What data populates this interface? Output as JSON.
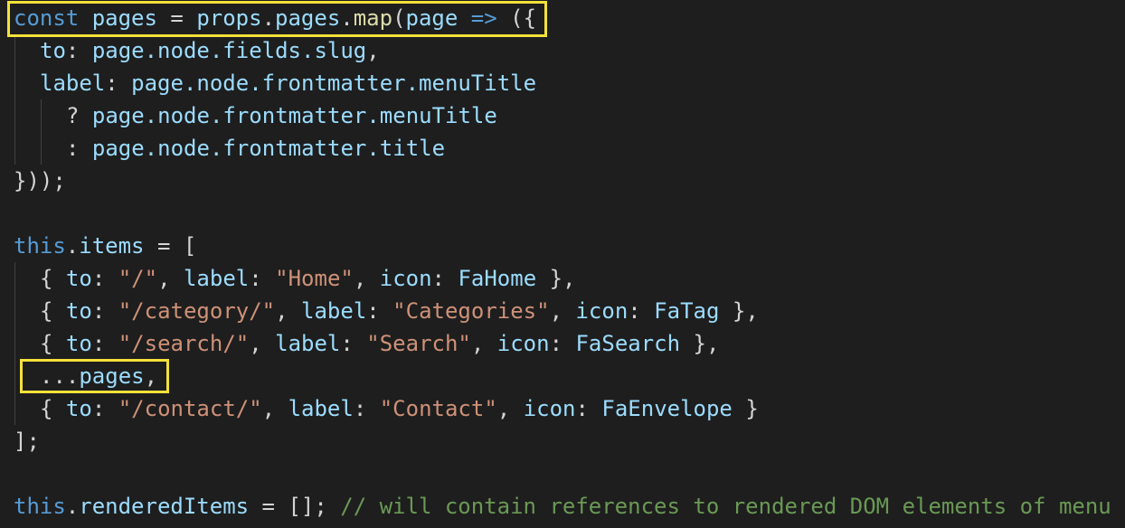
{
  "code": {
    "l1": {
      "kw_const": "const",
      "sp1": " ",
      "pages": "pages",
      "eq": " = ",
      "props": "props",
      "dot1": ".",
      "pages2": "pages",
      "dot2": ".",
      "map": "map",
      "paren": "(",
      "page": "page",
      "arrow_sp": " ",
      "arrow": "=>",
      "tail": " ({"
    },
    "l2": {
      "key": "to",
      "colon": ": ",
      "expr": "page.node.fields.slug",
      "comma": ","
    },
    "l3": {
      "key": "label",
      "colon": ": ",
      "expr": "page.node.frontmatter.menuTitle"
    },
    "l4": {
      "op": "? ",
      "expr": "page.node.frontmatter.menuTitle"
    },
    "l5": {
      "op": ": ",
      "expr": "page.node.frontmatter.title"
    },
    "l6": {
      "text": "}));"
    },
    "l8": {
      "this": "this",
      "dot": ".",
      "items": "items",
      "rest": " = ["
    },
    "l9": {
      "open": "{ ",
      "to": "to",
      "c1": ": ",
      "to_val": "\"/\"",
      "s1": ", ",
      "label": "label",
      "c2": ": ",
      "label_val": "\"Home\"",
      "s2": ", ",
      "icon": "icon",
      "c3": ": ",
      "icon_val": "FaHome",
      "close": " },"
    },
    "l10": {
      "open": "{ ",
      "to": "to",
      "c1": ": ",
      "to_val": "\"/category/\"",
      "s1": ", ",
      "label": "label",
      "c2": ": ",
      "label_val": "\"Categories\"",
      "s2": ", ",
      "icon": "icon",
      "c3": ": ",
      "icon_val": "FaTag",
      "close": " },"
    },
    "l11": {
      "open": "{ ",
      "to": "to",
      "c1": ": ",
      "to_val": "\"/search/\"",
      "s1": ", ",
      "label": "label",
      "c2": ": ",
      "label_val": "\"Search\"",
      "s2": ", ",
      "icon": "icon",
      "c3": ": ",
      "icon_val": "FaSearch",
      "close": " },"
    },
    "l12": {
      "spread": "...",
      "pages": "pages",
      "comma": ","
    },
    "l13": {
      "open": "{ ",
      "to": "to",
      "c1": ": ",
      "to_val": "\"/contact/\"",
      "s1": ", ",
      "label": "label",
      "c2": ": ",
      "label_val": "\"Contact\"",
      "s2": ", ",
      "icon": "icon",
      "c3": ": ",
      "icon_val": "FaEnvelope",
      "close": " }"
    },
    "l14": {
      "text": "];"
    },
    "l16": {
      "this": "this",
      "dot": ".",
      "prop": "renderedItems",
      "rest": " = []; ",
      "comment": "// will contain references to rendered DOM elements of menu"
    }
  },
  "colors": {
    "highlight_box": "#f4e13a",
    "background": "#1e1e1e",
    "keyword": "#569cd6",
    "variable": "#9cdcfe",
    "function": "#dcdcaa",
    "string": "#ce9178",
    "comment": "#6a9955"
  }
}
